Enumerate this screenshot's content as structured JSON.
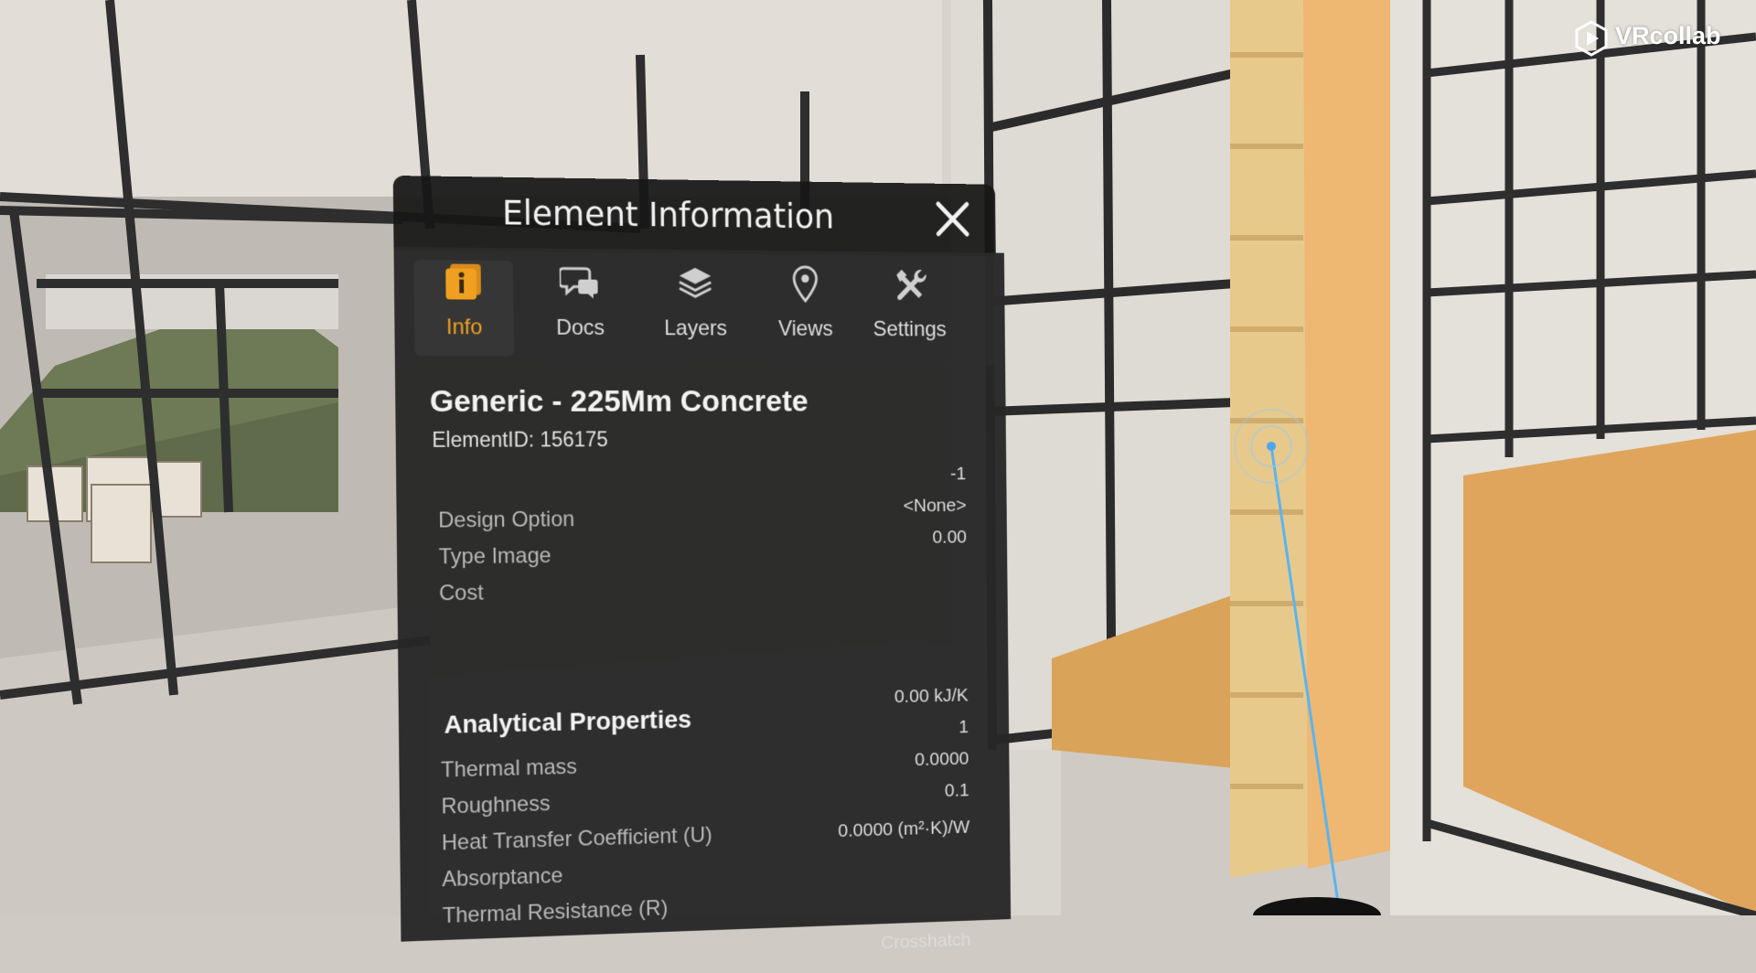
{
  "brand": {
    "name": "VRcollab"
  },
  "panel": {
    "title": "Element Information",
    "tabs": [
      {
        "label": "Info",
        "icon": "info-icon",
        "active": true
      },
      {
        "label": "Docs",
        "icon": "chat-bubbles-icon",
        "active": false
      },
      {
        "label": "Layers",
        "icon": "layers-icon",
        "active": false
      },
      {
        "label": "Views",
        "icon": "map-pin-icon",
        "active": false
      },
      {
        "label": "Settings",
        "icon": "tools-icon",
        "active": false
      }
    ],
    "element": {
      "name": "Generic - 225Mm Concrete",
      "id_text": "ElementID: 156175"
    },
    "properties": {
      "values_top": [
        "-1",
        "<None>",
        "0.00"
      ],
      "labels": [
        "Design Option",
        "Type Image",
        "Cost"
      ]
    },
    "analytical": {
      "title": "Analytical Properties",
      "labels": [
        "Thermal mass",
        "Roughness",
        "Heat Transfer Coefficient (U)",
        "Absorptance",
        "Thermal Resistance (R)"
      ],
      "values": [
        "0.00 kJ/K",
        "1",
        "0.0000",
        "0.1",
        "0.0000 (m²·K)/W"
      ]
    },
    "trailing_value": "Crosshatch"
  },
  "colors": {
    "accent": "#f0a020",
    "panel": "#262626",
    "laser": "#5ab4f0"
  }
}
